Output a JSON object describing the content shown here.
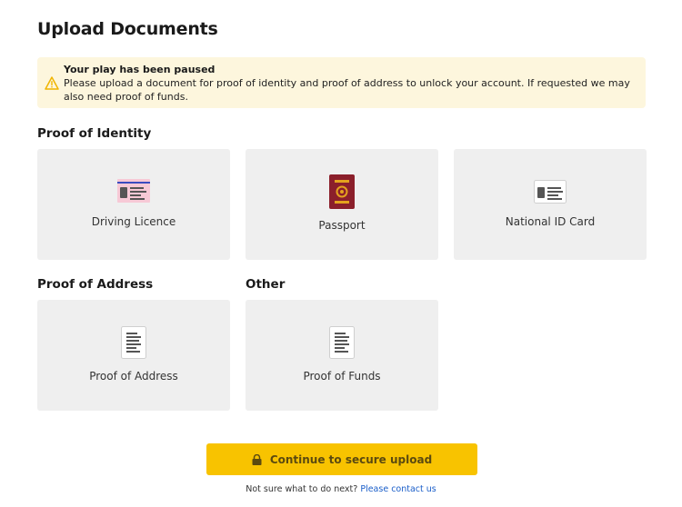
{
  "page": {
    "title": "Upload Documents"
  },
  "alert": {
    "icon": "warning-triangle-icon",
    "color": "#f0b400",
    "background": "#fdf6dd",
    "title": "Your play has been paused",
    "body": "Please upload a document for proof of identity and proof of address to unlock your account. If requested we may also need proof of funds."
  },
  "sections": {
    "identity": {
      "heading": "Proof of Identity",
      "tiles": [
        {
          "label": "Driving Licence",
          "icon": "driving-licence-icon"
        },
        {
          "label": "Passport",
          "icon": "passport-icon"
        },
        {
          "label": "National ID Card",
          "icon": "id-card-icon"
        }
      ]
    },
    "address": {
      "heading": "Proof of Address",
      "tiles": [
        {
          "label": "Proof of Address",
          "icon": "document-icon"
        }
      ]
    },
    "other": {
      "heading": "Other",
      "tiles": [
        {
          "label": "Proof of Funds",
          "icon": "document-icon"
        }
      ]
    }
  },
  "cta": {
    "label": "Continue to secure upload",
    "icon": "lock-icon",
    "color": "#f8c300"
  },
  "help": {
    "text": "Not sure what to do next?",
    "link": "Please contact us",
    "link_color": "#1a5ec9"
  },
  "colors": {
    "tile_background": "#efefef"
  }
}
